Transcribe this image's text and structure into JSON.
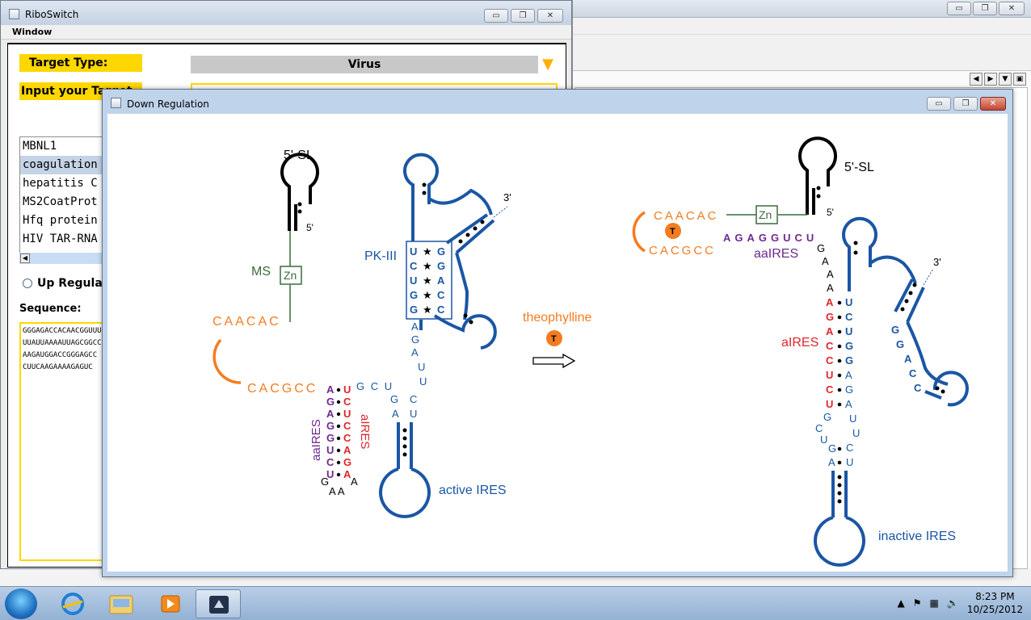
{
  "background_window": {
    "minimize": "▭",
    "restore": "❐",
    "close": "✕",
    "nav": [
      "◀",
      "▶",
      "▼",
      "▣"
    ]
  },
  "ribo": {
    "title": "RiboSwitch",
    "menu": "Window",
    "target_type_label": "Target Type:",
    "target_type_value": "Virus",
    "input_target_label": "Input your Target",
    "list_items": [
      "MBNL1",
      "coagulation",
      "hepatitis C",
      "MS2CoatProt",
      "Hfq protein",
      "HIV TAR-RNA"
    ],
    "selected_item_index": 1,
    "radio_label": "Up Regulat",
    "sequence_label": "Sequence:",
    "sequence_lines": [
      "GGGAGACCACAACGGUUUCCC",
      "UUAUUAAAAUUAGCGGCCG",
      "AAGAUGGACCGGGAGCC",
      "CUUCAAGAAAAGAGUC"
    ]
  },
  "down": {
    "title": "Down Regulation",
    "left": {
      "sl_label": "5'-SL",
      "five_prime": "5'",
      "ms_label": "MS",
      "zn_label": "Zn",
      "caacac": "CAACAC",
      "cacgcc": "CACGCC",
      "pk_label": "PK-III",
      "pk_left": [
        "U",
        "C",
        "U",
        "G",
        "G"
      ],
      "pk_right": [
        "G",
        "G",
        "A",
        "C",
        "C"
      ],
      "three_prime": "3'",
      "agauu": [
        "A",
        "G",
        "A",
        "U",
        "U"
      ],
      "gcu": "G C U",
      "ga": [
        "G",
        "A"
      ],
      "cu": [
        "C",
        "U"
      ],
      "aaires_col": [
        "A",
        "G",
        "A",
        "G",
        "G",
        "U",
        "C",
        "U"
      ],
      "aires_col": [
        "U",
        "C",
        "U",
        "C",
        "C",
        "A",
        "G",
        "A"
      ],
      "aaires_label": "aaIRES",
      "aires_label": "aIRES",
      "loop_g": "G",
      "loop_a": "A",
      "loop_aa": "A  A",
      "active_label": "active IRES"
    },
    "middle": {
      "theophylline": "theophylline",
      "t_label": "T"
    },
    "right": {
      "sl_label": "5'-SL",
      "five_prime": "5'",
      "zn_label": "Zn",
      "caacac": "CAACAC",
      "cacgcc": "CACGCC",
      "t_label": "T",
      "aaires_seq": "AGAGGUCU",
      "aaires_label": "aaIRES",
      "gaa": [
        "G",
        "A",
        "A"
      ],
      "aires_label": "aIRES",
      "aires_col": [
        "A",
        "G",
        "A",
        "C",
        "C",
        "U",
        "C",
        "U"
      ],
      "stem_right": [
        "U",
        "C",
        "U",
        "G",
        "G",
        "A",
        "G",
        "A"
      ],
      "three_prime": "3'",
      "ggacc": [
        "G",
        "G",
        "A",
        "C",
        "C"
      ],
      "lower_left": [
        "G",
        "C",
        "U",
        "G",
        "A"
      ],
      "lower_right": [
        "U",
        "U",
        "C",
        "U"
      ],
      "inactive_label": "inactive IRES"
    }
  },
  "taskbar": {
    "time": "8:23 PM",
    "date": "10/25/2012"
  },
  "colors": {
    "blue": "#1a56a4",
    "orange": "#f47c20",
    "purple": "#6e2a8e",
    "red": "#e0262b",
    "green": "#3a6b3a",
    "yellow": "#ffd700"
  }
}
